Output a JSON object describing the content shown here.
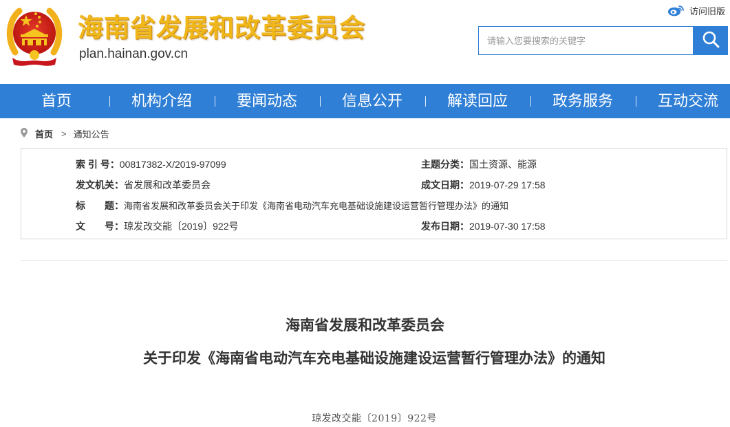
{
  "header": {
    "site_title": "海南省发展和改革委员会",
    "site_domain": "plan.hainan.gov.cn",
    "emblem_icon": "national-emblem-icon",
    "weibo_icon": "weibo-icon",
    "old_version_label": "访问旧版",
    "title_color": "#f0b71a"
  },
  "search": {
    "placeholder": "请输入您要搜索的关键字",
    "value": "",
    "button_icon": "search-icon"
  },
  "nav": {
    "background": "#2f7fd6",
    "items": [
      {
        "label": "首页"
      },
      {
        "label": "机构介绍"
      },
      {
        "label": "要闻动态"
      },
      {
        "label": "信息公开"
      },
      {
        "label": "解读回应"
      },
      {
        "label": "政务服务"
      },
      {
        "label": "互动交流"
      }
    ]
  },
  "breadcrumb": {
    "icon": "location-pin-icon",
    "home": "首页",
    "separator": ">",
    "current": "通知公告"
  },
  "info": {
    "index_label": "索 引 号：",
    "index_value": "00817382-X/2019-97099",
    "topic_label": "主题分类：",
    "topic_value": "国土资源、能源",
    "issuer_label": "发文机关：",
    "issuer_value": "省发展和改革委员会",
    "created_label": "成文日期：",
    "created_value": "2019-07-29 17:58",
    "title_label": "标　　题：",
    "title_value": "海南省发展和改革委员会关于印发《海南省电动汽车充电基础设施建设运营暂行管理办法》的通知",
    "docno_label": "文　　号：",
    "docno_value": "琼发改交能〔2019〕922号",
    "published_label": "发布日期：",
    "published_value": "2019-07-30 17:58"
  },
  "document": {
    "title_line1": "海南省发展和改革委员会",
    "title_line2": "关于印发《海南省电动汽车充电基础设施建设运营暂行管理办法》的通知",
    "doc_number": "琼发改交能〔2019〕922号"
  }
}
